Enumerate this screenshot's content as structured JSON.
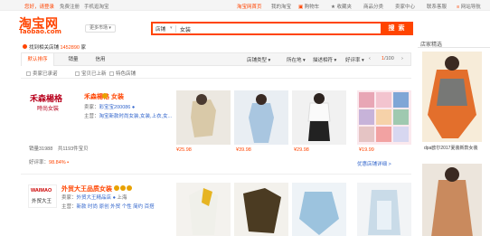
{
  "topbar": {
    "greeting": "您好，请登录",
    "register": "免费注册",
    "mobile": "手机逛淘宝",
    "home": "淘宝网首页",
    "my_taobao": "我的淘宝",
    "cart": "购物车",
    "favorites": "收藏夹",
    "categories": "商品分类",
    "seller_center": "卖家中心",
    "contact": "联系客服",
    "site_nav": "网站导航"
  },
  "logo": {
    "cn": "淘宝网",
    "en": "Taobao.com"
  },
  "market_button": "更多市场",
  "search": {
    "type": "店铺",
    "value": "女装",
    "button": "搜 索"
  },
  "results": {
    "prefix": "找到相关店铺",
    "count": "1452890",
    "suffix": "家"
  },
  "recommend": {
    "title": "店家精选",
    "captions": [
      "dpa欧尔2017夏装新款女装",
      ""
    ]
  },
  "tabs": [
    "默认排序",
    "销量",
    "信用"
  ],
  "filters": [
    "店铺类型",
    "所在地",
    "描述相符",
    "好评率"
  ],
  "pager": {
    "current": "1",
    "total": "/100"
  },
  "checkboxes": [
    "卖家已承诺",
    "宝贝已上新",
    "特色店铺"
  ],
  "shops": [
    {
      "name": "禾森楊格 女装",
      "seller_label": "卖家：",
      "seller": "彩宝宝200086",
      "main_label": "主营：",
      "main": "淘宝新款时尚女装,女装,上衣,女...",
      "sold": "销量31988",
      "items": "共1193件宝贝",
      "rate_label": "好评率：",
      "rate": "98.84%",
      "logo_text": "禾森楊格",
      "logo_sub": "時尚女裝",
      "prices": [
        "¥25.98",
        "¥39.98",
        "¥29.98",
        "¥19.99"
      ],
      "more": "优惠店铺详细 >"
    },
    {
      "name": "外贸大王品质女装",
      "seller_label": "卖家：",
      "seller": "外贸大王精品店",
      "location": "上海",
      "main_label": "主营：",
      "main": "新款 时尚 原创 外贸 个性 简约 百搭",
      "logo_text": "WAIMAO",
      "logo_sub": "外贸大王"
    }
  ]
}
